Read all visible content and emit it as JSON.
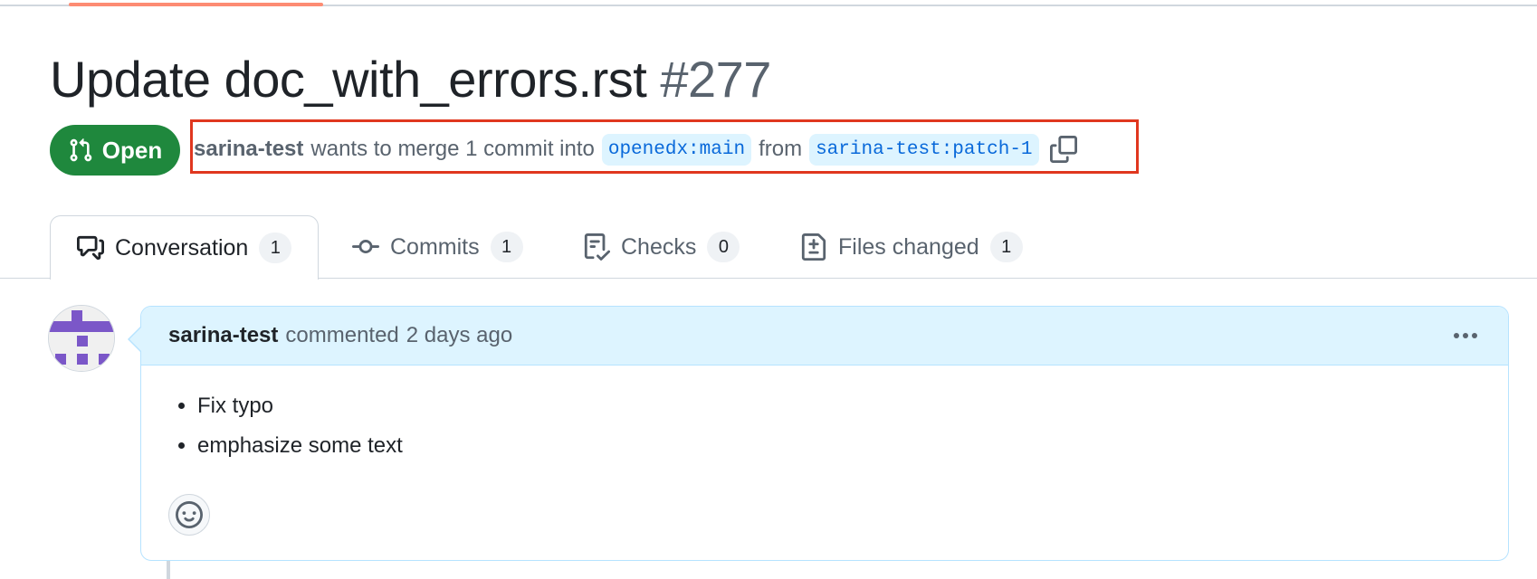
{
  "pr": {
    "title": "Update doc_with_errors.rst",
    "number": "#277",
    "state": "Open",
    "state_icon": "git-pull-request-icon",
    "author": "sarina-test",
    "merge_text": "wants to merge 1 commit into",
    "base_branch": "openedx:main",
    "from_text": "from",
    "head_branch": "sarina-test:patch-1"
  },
  "tabs": [
    {
      "label": "Conversation",
      "count": "1",
      "icon": "comment-discussion-icon",
      "selected": true
    },
    {
      "label": "Commits",
      "count": "1",
      "icon": "git-commit-icon",
      "selected": false
    },
    {
      "label": "Checks",
      "count": "0",
      "icon": "checklist-icon",
      "selected": false
    },
    {
      "label": "Files changed",
      "count": "1",
      "icon": "file-diff-icon",
      "selected": false
    }
  ],
  "comment": {
    "author": "sarina-test",
    "action": "commented",
    "time": "2 days ago",
    "items": [
      "Fix typo",
      "emphasize some text"
    ]
  },
  "colors": {
    "open_green": "#1f883d",
    "highlight_box": "#e0371f",
    "branch_bg": "#ddf4ff",
    "avatar_purple": "#7b57c8"
  }
}
